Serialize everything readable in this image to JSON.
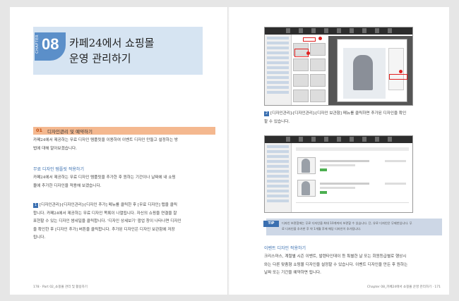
{
  "left": {
    "chapter": {
      "word": "CHAPTER",
      "number": "08",
      "title_line1": "카페24에서 쇼핑몰",
      "title_line2": "운영 관리하기"
    },
    "section": {
      "number": "01",
      "label": "디자인관리 및 예약하기"
    },
    "intro": [
      "카페24에서 제공하는 무료 디자인 템플릿을 이용하여 이벤트 디자인 만들고 설정하는 방",
      "법에 대해 알아보겠습니다."
    ],
    "sub1": "무료 디자인 템플릿 적용하기",
    "sub1_text": [
      "카페24에서 제공하는 무료 디자인 템플릿을 추가한 후 원하는 기간이나 날짜에 내 쇼핑",
      "몰에 추가한 디자인을 적용해 보겠습니다."
    ],
    "step1_num": "1",
    "step1_text": [
      "[디자인관리]-[디자인관리]-[디자인 추가] 메뉴를 클릭한 후 [무료 디자인] 탭을 클릭",
      "합니다. 카페24에서 제공하는 무료 디자인 목록이 나열됩니다. 자신의 쇼핑을 연결을 잘",
      "표현할 수 있는 디자인 썸네일을 클릭합니다. '디자인 상세보기' 팝업 창이 나타나면 디자인",
      "을 확인한 후 [디자인 추가] 버튼을 클릭합니다. 추가된 디자인은 디자인 보관함에 저장",
      "됩니다."
    ],
    "folio": "178 · Part 02_쇼핑몰 관리 및 활용하기"
  },
  "right": {
    "step2_num": "2",
    "step2_text": [
      "[디자인관리]-[디자인관리]-[디자인 보관함] 메뉴를 클릭하면 추가된 디자인을 확인",
      "할 수 있습니다."
    ],
    "tip_label": "TIP",
    "tip_text": [
      "디자인 보관함에는 무료 디자인을 최대 10개까지 보관할 수 있습니다. 단, 유료 디자인은 무제한입니다. 무",
      "료 디자인을 추가한 후 약 1개월 후에 해당 디자인이 추가됩니다."
    ],
    "sub2": "이벤트 디자인 적용하기",
    "sub2_text": [
      "크리스마스, 계절별 시즌 이벤트, 발렌타인데이 등 특별한 날 또는 회원등급별로 행상시",
      "와는 다른 맞춤형 쇼핑몰 디자인을 설정할 수 있습니다. 이벤트 디자인을 만든 후 원하는",
      "날짜 또는 기간을 예약하면 됩니다."
    ],
    "folio": "Chapter 08_카페24에서 쇼핑몰 운영 관리하기 · 171"
  },
  "colors": {
    "accent_blue": "#5b8fc9",
    "section_orange": "#f4b88f",
    "tip_bg": "#cdd7e6"
  }
}
